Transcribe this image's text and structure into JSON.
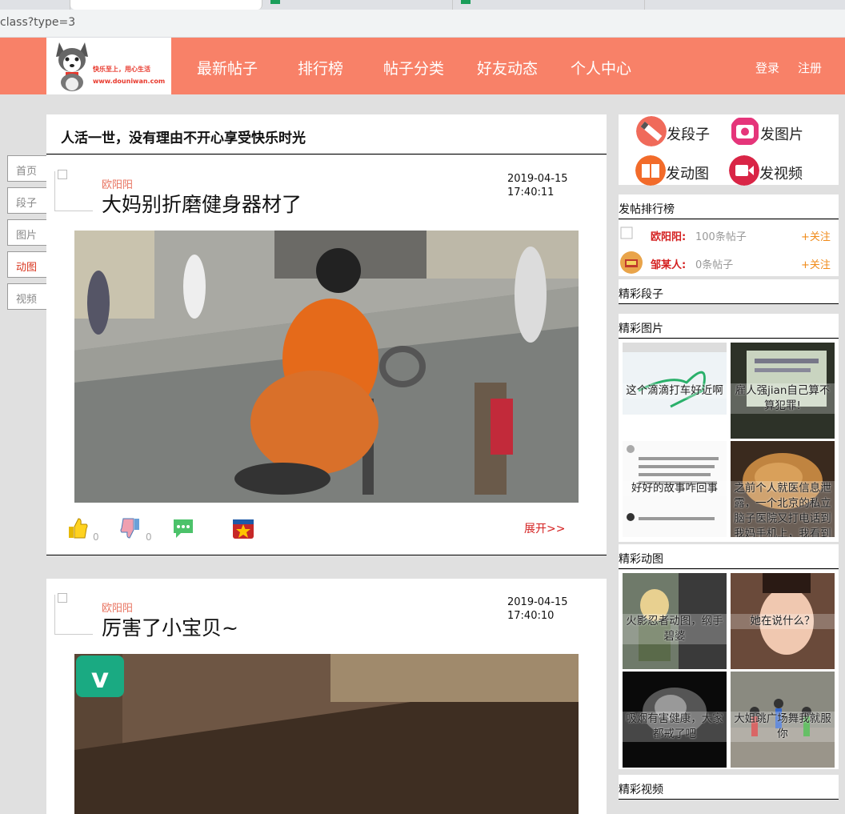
{
  "browser": {
    "url_fragment": "class?type=3"
  },
  "site": {
    "logo_slogan": "快乐至上，用心生活",
    "logo_url": "www.douniwan.com",
    "nav": [
      "最新帖子",
      "排行榜",
      "帖子分类",
      "好友动态",
      "个人中心"
    ],
    "login": "登录",
    "register": "注册"
  },
  "sidemenu": {
    "items": [
      "首页",
      "段子",
      "图片",
      "动图",
      "视频"
    ],
    "active_index": 3
  },
  "main": {
    "headline": "人活一世，没有理由不开心享受快乐时光",
    "posts": [
      {
        "author": "欧阳阳",
        "title": "大妈别折磨健身器材了",
        "date": "2019-04-15",
        "time": "17:40:11",
        "likes": "0",
        "dislikes": "0",
        "expand": "展开>>"
      },
      {
        "author": "欧阳阳",
        "title": "厉害了小宝贝~",
        "date": "2019-04-15",
        "time": "17:40:10"
      }
    ]
  },
  "sidebar": {
    "publish": [
      {
        "label": "发段子",
        "icon": "pencil-icon",
        "color": "#f06a5a"
      },
      {
        "label": "发图片",
        "icon": "camera-icon",
        "color": "#e5357a"
      },
      {
        "label": "发动图",
        "icon": "book-icon",
        "color": "#f26b2a"
      },
      {
        "label": "发视频",
        "icon": "video-camera-icon",
        "color": "#d92546"
      }
    ],
    "ranking": {
      "title": "发帖排行榜",
      "rows": [
        {
          "name": "欧阳阳:",
          "count": "100条帖子",
          "follow": "+关注"
        },
        {
          "name": "邹某人:",
          "count": "0条帖子",
          "follow": "+关注"
        }
      ]
    },
    "sections": {
      "jokes": "精彩段子",
      "images": "精彩图片",
      "gifs": "精彩动图",
      "videos": "精彩视频"
    },
    "image_items": [
      "这个滴滴打车好近啊",
      "雇人强jian自己算不算犯罪!",
      "好好的故事咋回事",
      "之前个人就医信息泄露，一个北京的私立脑子医院又打电话到我妈手机上，我看到"
    ],
    "gif_items": [
      "火影忍者动图，纲手碧婆",
      "她在说什么？",
      "吸烟有害健康，大家都戒了吧",
      "大姐跳广场舞我就服你"
    ]
  },
  "colors": {
    "nav_bg": "#f88168",
    "accent_red": "#d42020",
    "follow_orange": "#f08b1a",
    "author_color": "#e8735f"
  }
}
